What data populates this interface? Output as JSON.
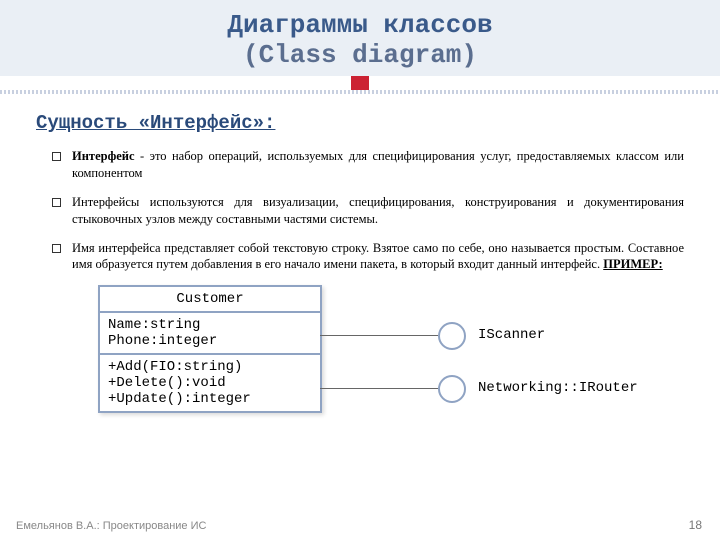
{
  "header": {
    "title_ru": "Диаграммы классов",
    "title_en": "(Class diagram)"
  },
  "subtitle": "Сущность «Интерфейс»:",
  "bullets": [
    {
      "bold": "Интерфейс",
      "rest": " - это набор операций, используемых для специфицирования услуг, предоставляемых классом или компонентом"
    },
    {
      "bold": "",
      "rest": "Интерфейсы используются для визуализации, специфицирования, конструирования и документирования стыковочных узлов между составными частями системы."
    },
    {
      "bold": "",
      "rest": "Имя интерфейса представляет собой текстовую строку. Взятое само по себе, оно называется простым. Составное имя образуется путем добавления в его начало имени пакета, в который входит данный интерфейс. ",
      "tail": "ПРИМЕР:"
    }
  ],
  "uml": {
    "class_name": "Customer",
    "attributes": "Name:string\nPhone:integer",
    "operations": "+Add(FIO:string)\n+Delete():void\n+Update():integer"
  },
  "interfaces": {
    "i1": "IScanner",
    "i2": "Networking::IRouter"
  },
  "footer": "Емельянов В.А.: Проектирование ИС",
  "page": "18"
}
